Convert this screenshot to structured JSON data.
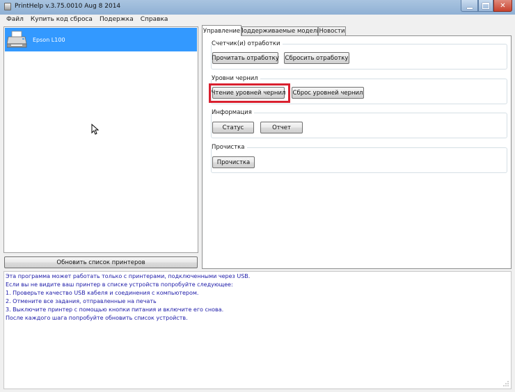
{
  "window": {
    "title": "PrintHelp v.3.75.0010 Aug  8 2014"
  },
  "menu": [
    "Файл",
    "Купить код сброса",
    "Подержка",
    "Справка"
  ],
  "printers": [
    {
      "name": "Epson L100",
      "selected": true
    }
  ],
  "refresh_button": "Обновить список принтеров",
  "tabs": [
    {
      "label": "Управление",
      "active": true
    },
    {
      "label": "Поддерживаемые модели",
      "active": false
    },
    {
      "label": "Новости",
      "active": false
    }
  ],
  "groups": {
    "counters": {
      "title": "Счетчик(и) отработки",
      "read_button": "Прочитать отработку",
      "reset_button": "Сбросить отработку"
    },
    "ink": {
      "title": "Уровни чернил",
      "read_button": "Чтение уровней чернил",
      "reset_button": "Сброс уровней чернил"
    },
    "info": {
      "title": "Информация",
      "status_button": "Статус",
      "report_button": "Отчет"
    },
    "cleaning": {
      "title": "Прочистка",
      "clean_button": "Прочистка"
    }
  },
  "log_lines": [
    "Эта программа может работать только с принтерами, подключенными через USB.",
    "Если вы не видите ваш принтер в списке устройств попробуйте следующее:",
    "1. Проверьте качество USB кабеля и соединения с компьютером.",
    "2. Отмените все задания, отправленные на печать",
    "3. Выключите принтер с помощью кнопки питания и включите его снова.",
    "После каждого шага попробуйте обновить список устройств."
  ],
  "colors": {
    "selection": "#3399ff",
    "highlight": "#d9202f",
    "log_text": "#1c1aa8"
  }
}
